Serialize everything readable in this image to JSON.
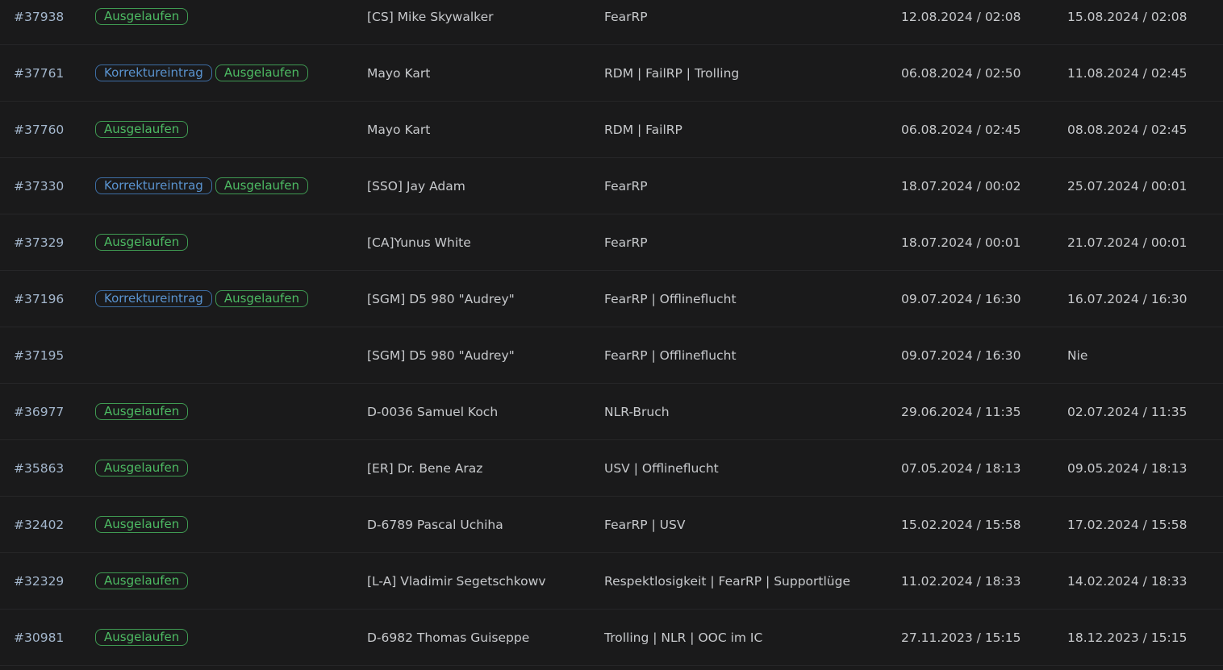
{
  "rows": [
    {
      "id": "#37938",
      "tags": [
        "Ausgelaufen"
      ],
      "name": "[CS] Mike Skywalker",
      "reason": "FearRP",
      "start": "12.08.2024 / 02:08",
      "end": "15.08.2024 / 02:08"
    },
    {
      "id": "#37761",
      "tags": [
        "Korrektureintrag",
        "Ausgelaufen"
      ],
      "name": "Mayo Kart",
      "reason": "RDM | FailRP | Trolling",
      "start": "06.08.2024 / 02:50",
      "end": "11.08.2024 / 02:45"
    },
    {
      "id": "#37760",
      "tags": [
        "Ausgelaufen"
      ],
      "name": "Mayo Kart",
      "reason": "RDM | FailRP",
      "start": "06.08.2024 / 02:45",
      "end": "08.08.2024 / 02:45"
    },
    {
      "id": "#37330",
      "tags": [
        "Korrektureintrag",
        "Ausgelaufen"
      ],
      "name": "[SSO] Jay Adam",
      "reason": "FearRP",
      "start": "18.07.2024 / 00:02",
      "end": "25.07.2024 / 00:01"
    },
    {
      "id": "#37329",
      "tags": [
        "Ausgelaufen"
      ],
      "name": "[CA]Yunus White",
      "reason": "FearRP",
      "start": "18.07.2024 / 00:01",
      "end": "21.07.2024 / 00:01"
    },
    {
      "id": "#37196",
      "tags": [
        "Korrektureintrag",
        "Ausgelaufen"
      ],
      "name": "[SGM] D5 980 \"Audrey\"",
      "reason": "FearRP | Offlineflucht",
      "start": "09.07.2024 / 16:30",
      "end": "16.07.2024 / 16:30"
    },
    {
      "id": "#37195",
      "tags": [],
      "name": "[SGM] D5 980 \"Audrey\"",
      "reason": "FearRP | Offlineflucht",
      "start": "09.07.2024 / 16:30",
      "end": "Nie"
    },
    {
      "id": "#36977",
      "tags": [
        "Ausgelaufen"
      ],
      "name": "D-0036 Samuel Koch",
      "reason": "NLR-Bruch",
      "start": "29.06.2024 / 11:35",
      "end": "02.07.2024 / 11:35"
    },
    {
      "id": "#35863",
      "tags": [
        "Ausgelaufen"
      ],
      "name": "[ER] Dr. Bene Araz",
      "reason": "USV | Offlineflucht",
      "start": "07.05.2024 / 18:13",
      "end": "09.05.2024 / 18:13"
    },
    {
      "id": "#32402",
      "tags": [
        "Ausgelaufen"
      ],
      "name": "D-6789 Pascal Uchiha",
      "reason": "FearRP | USV",
      "start": "15.02.2024 / 15:58",
      "end": "17.02.2024 / 15:58"
    },
    {
      "id": "#32329",
      "tags": [
        "Ausgelaufen"
      ],
      "name": "[L-A] Vladimir Segetschkowv",
      "reason": "Respektlosigkeit | FearRP | Supportlüge",
      "start": "11.02.2024 / 18:33",
      "end": "14.02.2024 / 18:33"
    },
    {
      "id": "#30981",
      "tags": [
        "Ausgelaufen"
      ],
      "name": "D-6982 Thomas Guiseppe",
      "reason": "Trolling | NLR | OOC im IC",
      "start": "27.11.2023 / 15:15",
      "end": "18.12.2023 / 15:15"
    }
  ],
  "colors": {
    "background": "#1a1a1b",
    "text": "#c7c9cc",
    "id_link": "#a3b6cc",
    "badge_expired": "#4dbb63",
    "badge_correction": "#5a93cf"
  }
}
